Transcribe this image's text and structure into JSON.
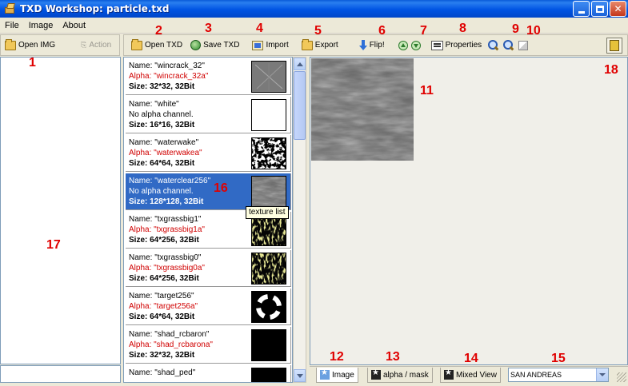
{
  "window": {
    "title": "TXD Workshop: particle.txd"
  },
  "menu": [
    "File",
    "Image",
    "About"
  ],
  "left_toolbar": {
    "open_img": "Open IMG",
    "action": "Action"
  },
  "toolbar": {
    "open_txd": "Open TXD",
    "save_txd": "Save TXD",
    "import": "Import",
    "export": "Export",
    "flip": "Flip!",
    "properties": "Properties"
  },
  "texture_list": [
    {
      "name": "Name: \"wincrack_32\"",
      "alpha": "Alpha: \"wincrack_32a\"",
      "size": "Size: 32*32, 32Bit",
      "has_alpha": true,
      "thumb": "crack"
    },
    {
      "name": "Name: \"white\"",
      "alpha": "No alpha channel.",
      "size": "Size: 16*16, 32Bit",
      "has_alpha": false,
      "thumb": "white"
    },
    {
      "name": "Name: \"waterwake\"",
      "alpha": "Alpha: \"waterwakea\"",
      "size": "Size: 64*64, 32Bit",
      "has_alpha": true,
      "thumb": "foam"
    },
    {
      "name": "Name: \"waterclear256\"",
      "alpha": "No alpha channel.",
      "size": "Size: 128*128, 32Bit",
      "has_alpha": false,
      "thumb": "water",
      "selected": true
    },
    {
      "name": "Name: \"txgrassbig1\"",
      "alpha": "Alpha: \"txgrassbig1a\"",
      "size": "Size: 64*256, 32Bit",
      "has_alpha": true,
      "thumb": "grass"
    },
    {
      "name": "Name: \"txgrassbig0\"",
      "alpha": "Alpha: \"txgrassbig0a\"",
      "size": "Size: 64*256, 32Bit",
      "has_alpha": true,
      "thumb": "grass"
    },
    {
      "name": "Name: \"target256\"",
      "alpha": "Alpha: \"target256a\"",
      "size": "Size: 64*64, 32Bit",
      "has_alpha": true,
      "thumb": "target"
    },
    {
      "name": "Name: \"shad_rcbaron\"",
      "alpha": "Alpha: \"shad_rcbarona\"",
      "size": "Size: 32*32, 32Bit",
      "has_alpha": true,
      "thumb": "black"
    },
    {
      "name": "Name: \"shad_ped\"",
      "alpha": "",
      "size": "",
      "has_alpha": true,
      "thumb": "black"
    }
  ],
  "tooltip": "texture list",
  "tabs": {
    "image": "Image",
    "alpha_mask": "alpha / mask",
    "mixed_view": "Mixed View"
  },
  "game_select": {
    "value": "SAN ANDREAS"
  },
  "annotations": [
    "1",
    "2",
    "3",
    "4",
    "5",
    "6",
    "7",
    "8",
    "9",
    "10",
    "11",
    "12",
    "13",
    "14",
    "15",
    "16",
    "17",
    "18"
  ],
  "colors": {
    "alpha_text": "#d00000",
    "selection": "#316ac5",
    "annotation": "#e00000"
  }
}
